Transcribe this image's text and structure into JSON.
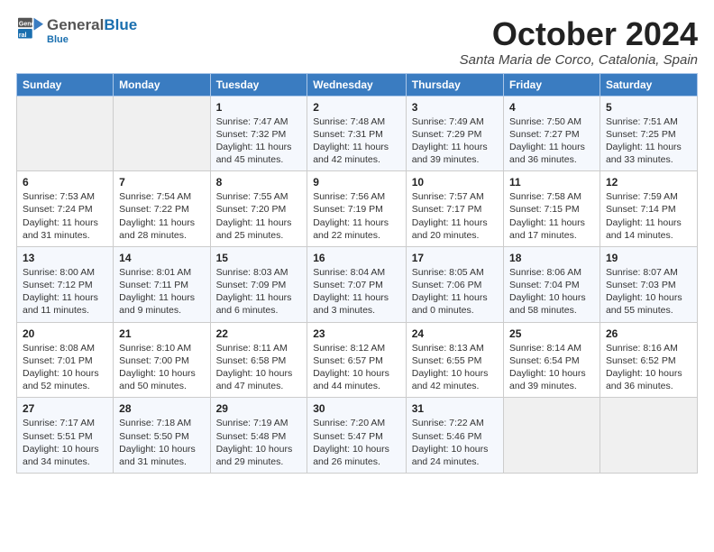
{
  "header": {
    "logo_general": "General",
    "logo_blue": "Blue",
    "month_title": "October 2024",
    "location": "Santa Maria de Corco, Catalonia, Spain"
  },
  "weekdays": [
    "Sunday",
    "Monday",
    "Tuesday",
    "Wednesday",
    "Thursday",
    "Friday",
    "Saturday"
  ],
  "weeks": [
    [
      {
        "day": "",
        "detail": ""
      },
      {
        "day": "",
        "detail": ""
      },
      {
        "day": "1",
        "detail": "Sunrise: 7:47 AM\nSunset: 7:32 PM\nDaylight: 11 hours and 45 minutes."
      },
      {
        "day": "2",
        "detail": "Sunrise: 7:48 AM\nSunset: 7:31 PM\nDaylight: 11 hours and 42 minutes."
      },
      {
        "day": "3",
        "detail": "Sunrise: 7:49 AM\nSunset: 7:29 PM\nDaylight: 11 hours and 39 minutes."
      },
      {
        "day": "4",
        "detail": "Sunrise: 7:50 AM\nSunset: 7:27 PM\nDaylight: 11 hours and 36 minutes."
      },
      {
        "day": "5",
        "detail": "Sunrise: 7:51 AM\nSunset: 7:25 PM\nDaylight: 11 hours and 33 minutes."
      }
    ],
    [
      {
        "day": "6",
        "detail": "Sunrise: 7:53 AM\nSunset: 7:24 PM\nDaylight: 11 hours and 31 minutes."
      },
      {
        "day": "7",
        "detail": "Sunrise: 7:54 AM\nSunset: 7:22 PM\nDaylight: 11 hours and 28 minutes."
      },
      {
        "day": "8",
        "detail": "Sunrise: 7:55 AM\nSunset: 7:20 PM\nDaylight: 11 hours and 25 minutes."
      },
      {
        "day": "9",
        "detail": "Sunrise: 7:56 AM\nSunset: 7:19 PM\nDaylight: 11 hours and 22 minutes."
      },
      {
        "day": "10",
        "detail": "Sunrise: 7:57 AM\nSunset: 7:17 PM\nDaylight: 11 hours and 20 minutes."
      },
      {
        "day": "11",
        "detail": "Sunrise: 7:58 AM\nSunset: 7:15 PM\nDaylight: 11 hours and 17 minutes."
      },
      {
        "day": "12",
        "detail": "Sunrise: 7:59 AM\nSunset: 7:14 PM\nDaylight: 11 hours and 14 minutes."
      }
    ],
    [
      {
        "day": "13",
        "detail": "Sunrise: 8:00 AM\nSunset: 7:12 PM\nDaylight: 11 hours and 11 minutes."
      },
      {
        "day": "14",
        "detail": "Sunrise: 8:01 AM\nSunset: 7:11 PM\nDaylight: 11 hours and 9 minutes."
      },
      {
        "day": "15",
        "detail": "Sunrise: 8:03 AM\nSunset: 7:09 PM\nDaylight: 11 hours and 6 minutes."
      },
      {
        "day": "16",
        "detail": "Sunrise: 8:04 AM\nSunset: 7:07 PM\nDaylight: 11 hours and 3 minutes."
      },
      {
        "day": "17",
        "detail": "Sunrise: 8:05 AM\nSunset: 7:06 PM\nDaylight: 11 hours and 0 minutes."
      },
      {
        "day": "18",
        "detail": "Sunrise: 8:06 AM\nSunset: 7:04 PM\nDaylight: 10 hours and 58 minutes."
      },
      {
        "day": "19",
        "detail": "Sunrise: 8:07 AM\nSunset: 7:03 PM\nDaylight: 10 hours and 55 minutes."
      }
    ],
    [
      {
        "day": "20",
        "detail": "Sunrise: 8:08 AM\nSunset: 7:01 PM\nDaylight: 10 hours and 52 minutes."
      },
      {
        "day": "21",
        "detail": "Sunrise: 8:10 AM\nSunset: 7:00 PM\nDaylight: 10 hours and 50 minutes."
      },
      {
        "day": "22",
        "detail": "Sunrise: 8:11 AM\nSunset: 6:58 PM\nDaylight: 10 hours and 47 minutes."
      },
      {
        "day": "23",
        "detail": "Sunrise: 8:12 AM\nSunset: 6:57 PM\nDaylight: 10 hours and 44 minutes."
      },
      {
        "day": "24",
        "detail": "Sunrise: 8:13 AM\nSunset: 6:55 PM\nDaylight: 10 hours and 42 minutes."
      },
      {
        "day": "25",
        "detail": "Sunrise: 8:14 AM\nSunset: 6:54 PM\nDaylight: 10 hours and 39 minutes."
      },
      {
        "day": "26",
        "detail": "Sunrise: 8:16 AM\nSunset: 6:52 PM\nDaylight: 10 hours and 36 minutes."
      }
    ],
    [
      {
        "day": "27",
        "detail": "Sunrise: 7:17 AM\nSunset: 5:51 PM\nDaylight: 10 hours and 34 minutes."
      },
      {
        "day": "28",
        "detail": "Sunrise: 7:18 AM\nSunset: 5:50 PM\nDaylight: 10 hours and 31 minutes."
      },
      {
        "day": "29",
        "detail": "Sunrise: 7:19 AM\nSunset: 5:48 PM\nDaylight: 10 hours and 29 minutes."
      },
      {
        "day": "30",
        "detail": "Sunrise: 7:20 AM\nSunset: 5:47 PM\nDaylight: 10 hours and 26 minutes."
      },
      {
        "day": "31",
        "detail": "Sunrise: 7:22 AM\nSunset: 5:46 PM\nDaylight: 10 hours and 24 minutes."
      },
      {
        "day": "",
        "detail": ""
      },
      {
        "day": "",
        "detail": ""
      }
    ]
  ]
}
